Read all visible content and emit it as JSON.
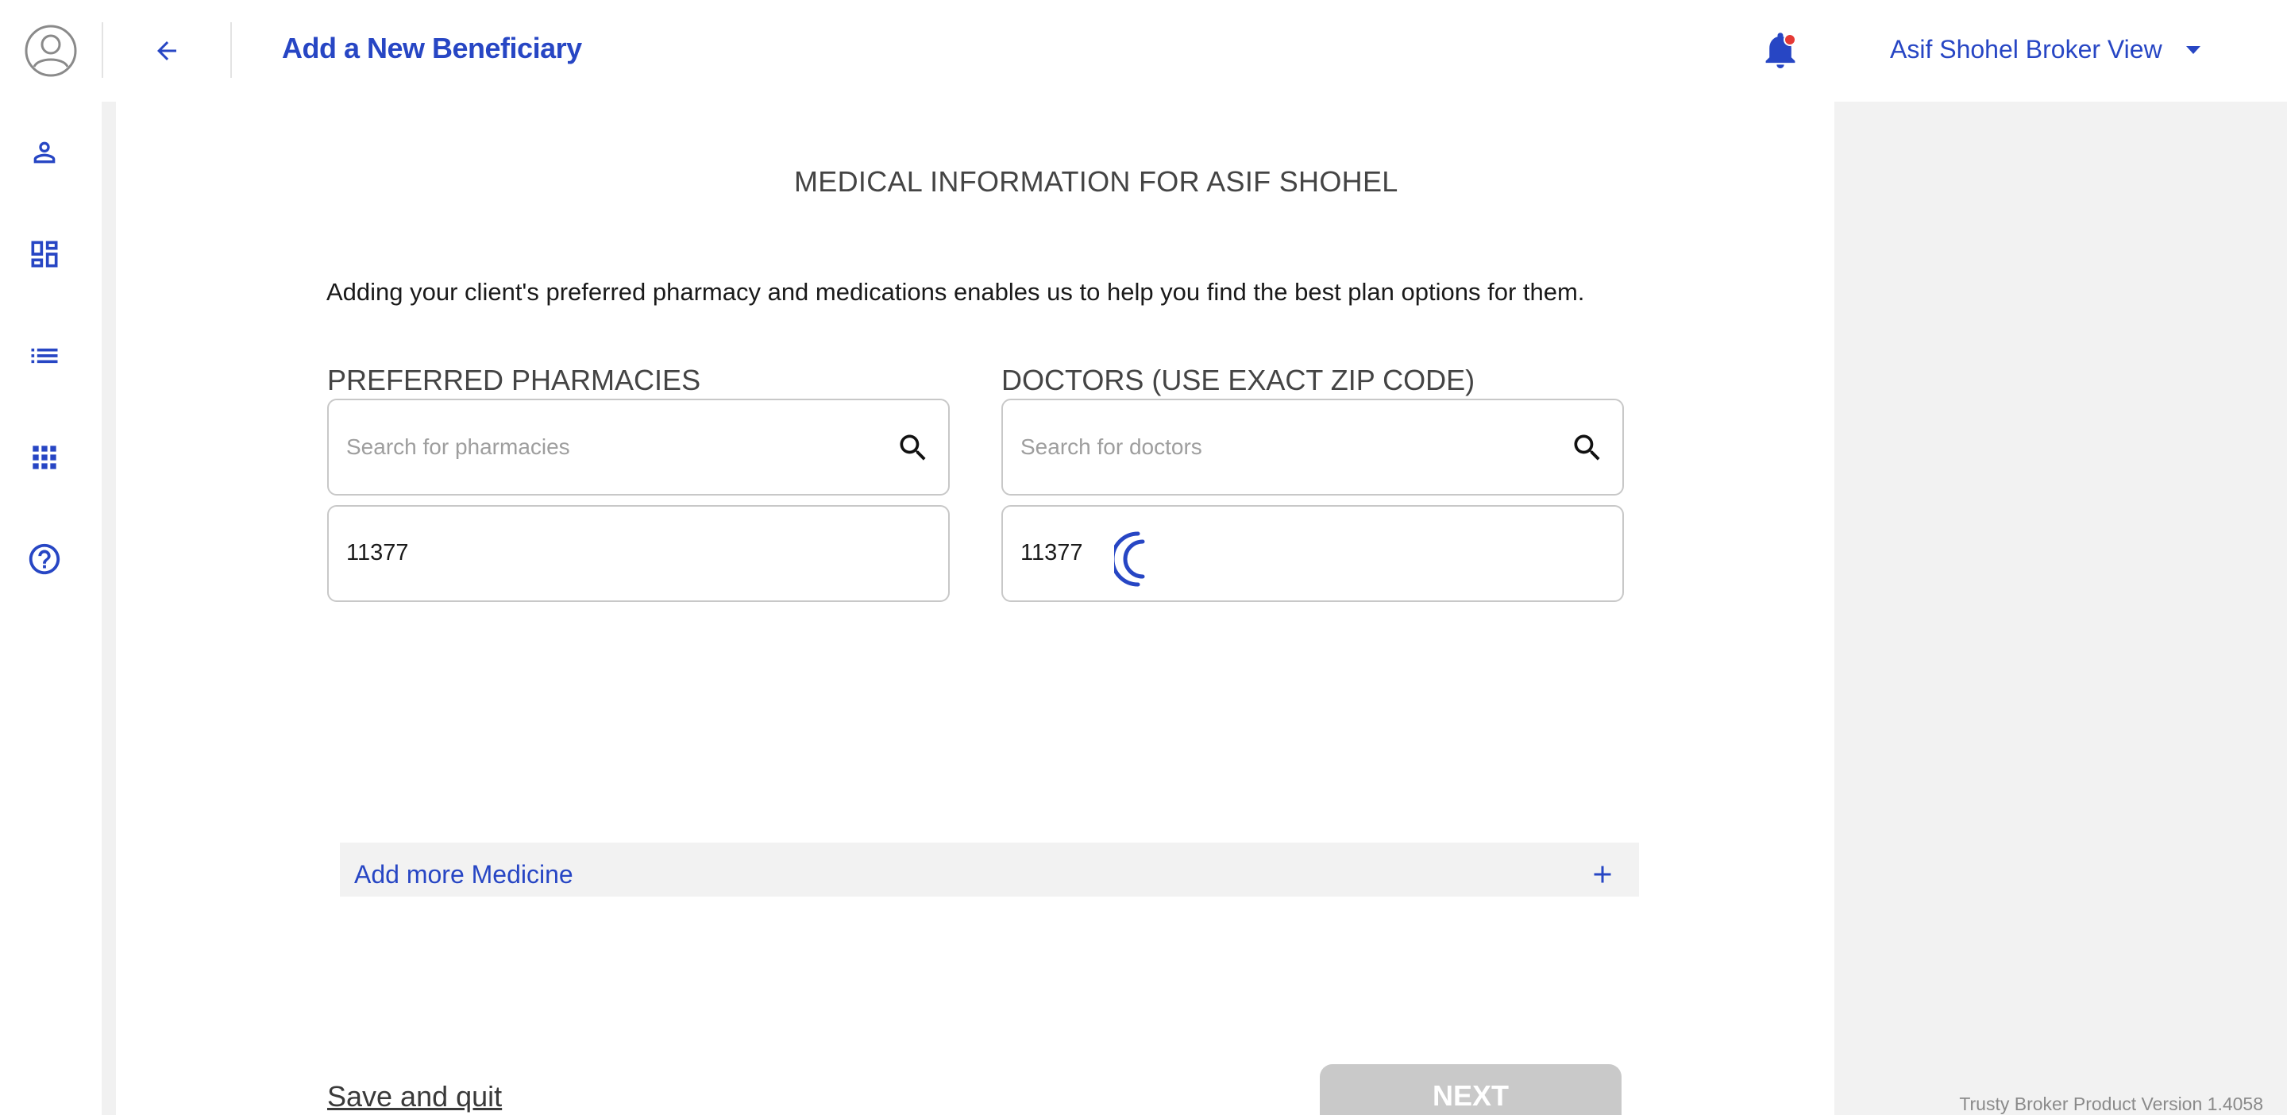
{
  "header": {
    "title": "Add a New Beneficiary",
    "user_name": "Asif Shohel Broker View",
    "colors": {
      "accent": "#2746c4",
      "notification_dot": "#e53935"
    }
  },
  "sidebar": {
    "items": [
      {
        "icon": "person-icon"
      },
      {
        "icon": "dashboard-icon"
      },
      {
        "icon": "list-icon"
      },
      {
        "icon": "apps-grid-icon"
      },
      {
        "icon": "help-icon"
      }
    ]
  },
  "main": {
    "section_title": "MEDICAL INFORMATION FOR ASIF SHOHEL",
    "intro": "Adding your client's preferred pharmacy and medications enables us to help you find the best plan options for them.",
    "pharmacies": {
      "label": "PREFERRED PHARMACIES",
      "search_placeholder": "Search for pharmacies",
      "zip": "11377"
    },
    "doctors": {
      "label": "DOCTORS (USE EXACT ZIP CODE)",
      "search_placeholder": "Search for doctors",
      "zip": "11377",
      "loading": true
    },
    "add_more_label": "Add more Medicine",
    "save_quit_label": "Save and quit",
    "next_label": "NEXT"
  },
  "footer": {
    "version": "Trusty Broker Product Version 1.4058"
  }
}
